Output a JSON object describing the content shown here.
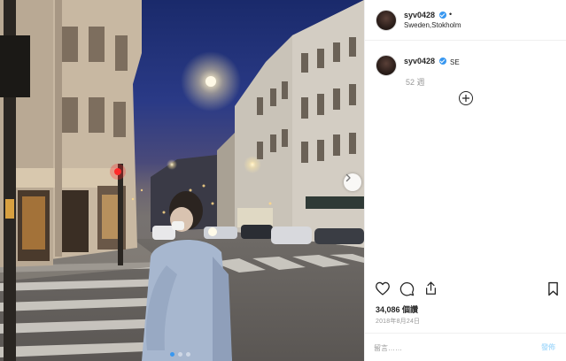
{
  "post": {
    "username": "syv0428",
    "header_bullet": "•",
    "location": "Sweden,Stokholm",
    "caption": {
      "username": "syv0428",
      "text": "SE",
      "age": "52 週"
    },
    "likes_count": "34,086",
    "likes_label": "個讚",
    "date": "2018年8月24日",
    "comment_placeholder": "留言……",
    "post_label": "發佈"
  },
  "carousel": {
    "total": 3,
    "current": 1
  },
  "icons": {
    "like": "heart-icon",
    "comment": "comment-icon",
    "share": "share-icon",
    "save": "bookmark-icon",
    "more_comments": "plus-circle-icon",
    "next": "chevron-right-icon",
    "verified": "verified-badge-icon"
  },
  "colors": {
    "verified": "#3897f0",
    "text": "#262626",
    "muted": "#999999",
    "post_button": "#b2dffc",
    "border": "#efefef"
  }
}
